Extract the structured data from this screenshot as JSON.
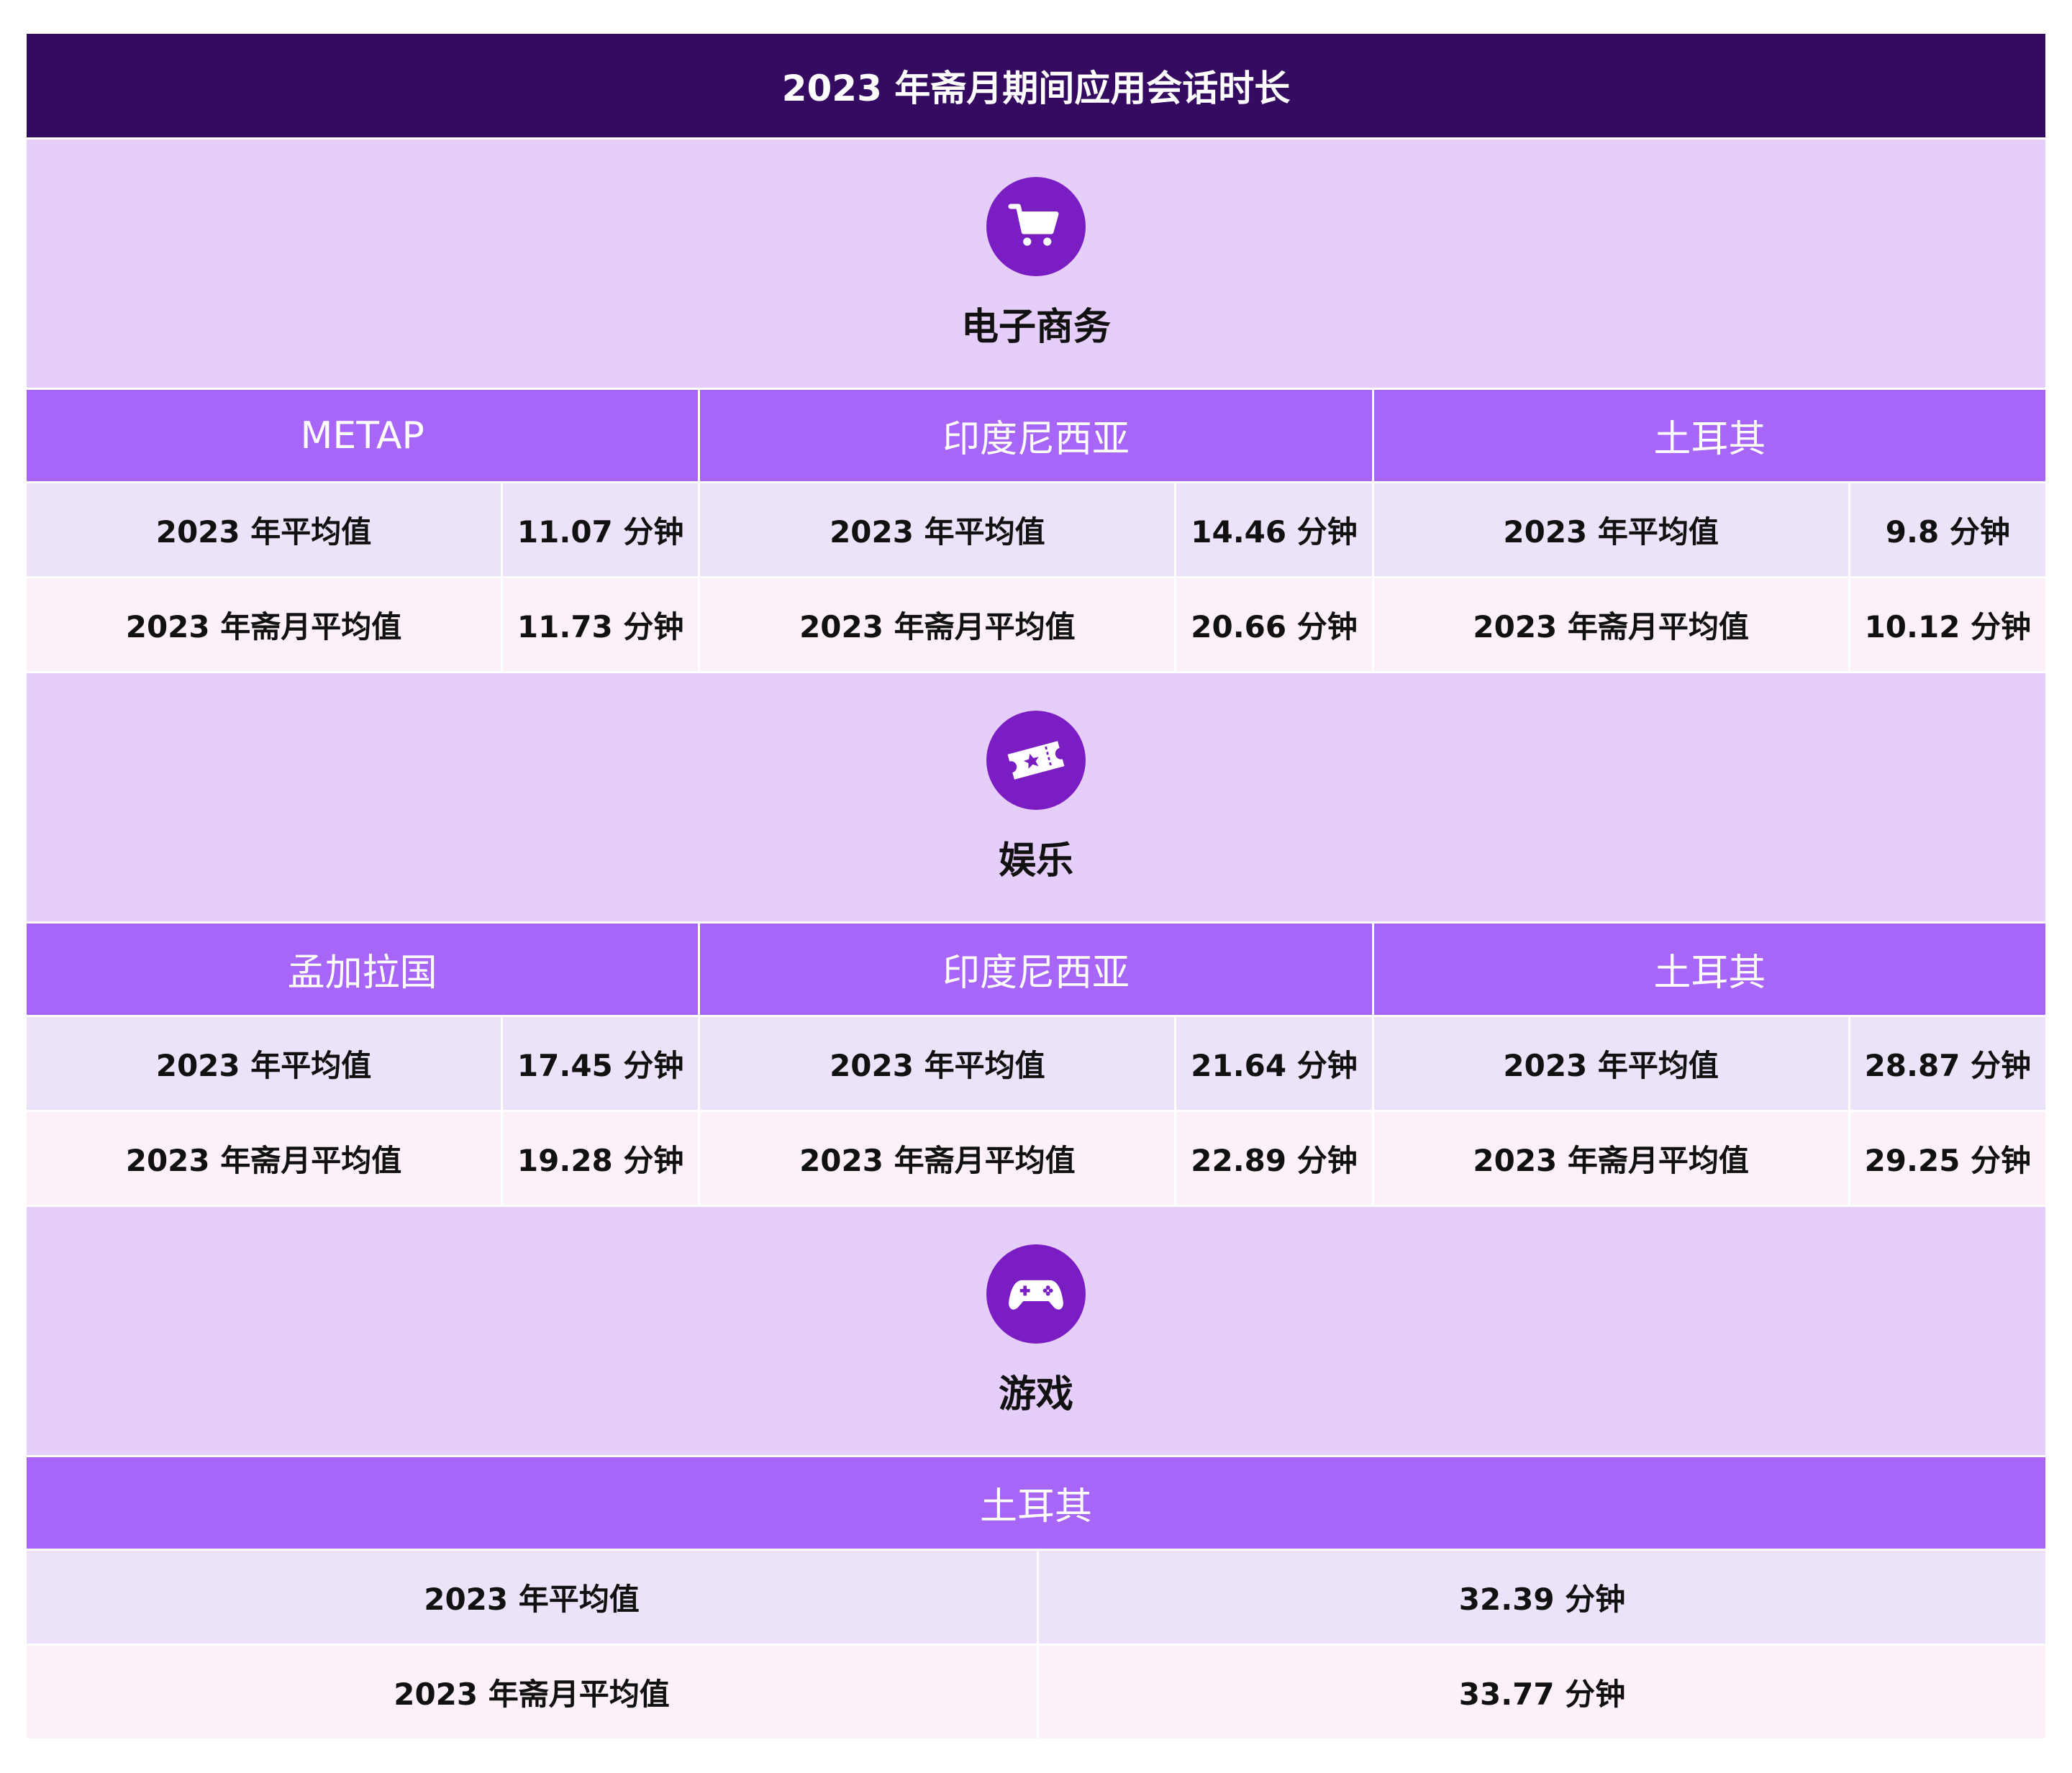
{
  "title": "2023 年斋月期间应用会话时长",
  "sections": [
    {
      "name": "电子商务",
      "icon": "shopping-cart-icon",
      "regions": [
        {
          "name": "METAP",
          "avg_label": "2023 年平均值",
          "avg_value": "11.07 分钟",
          "ramadan_label": "2023 年斋月平均值",
          "ramadan_value": "11.73 分钟"
        },
        {
          "name": "印度尼西亚",
          "avg_label": "2023 年平均值",
          "avg_value": "14.46 分钟",
          "ramadan_label": "2023 年斋月平均值",
          "ramadan_value": "20.66 分钟"
        },
        {
          "name": "土耳其",
          "avg_label": "2023 年平均值",
          "avg_value": "9.8 分钟",
          "ramadan_label": "2023 年斋月平均值",
          "ramadan_value": "10.12 分钟"
        }
      ]
    },
    {
      "name": "娱乐",
      "icon": "ticket-icon",
      "regions": [
        {
          "name": "孟加拉国",
          "avg_label": "2023 年平均值",
          "avg_value": "17.45 分钟",
          "ramadan_label": "2023 年斋月平均值",
          "ramadan_value": "19.28 分钟"
        },
        {
          "name": "印度尼西亚",
          "avg_label": "2023 年平均值",
          "avg_value": "21.64 分钟",
          "ramadan_label": "2023 年斋月平均值",
          "ramadan_value": "22.89 分钟"
        },
        {
          "name": "土耳其",
          "avg_label": "2023 年平均值",
          "avg_value": "28.87 分钟",
          "ramadan_label": "2023 年斋月平均值",
          "ramadan_value": "29.25 分钟"
        }
      ]
    },
    {
      "name": "游戏",
      "icon": "gamepad-icon",
      "regions": [
        {
          "name": "土耳其",
          "avg_label": "2023 年平均值",
          "avg_value": "32.39 分钟",
          "ramadan_label": "2023 年斋月平均值",
          "ramadan_value": "33.77 分钟"
        }
      ]
    }
  ],
  "colors": {
    "title_bg": "#350b62",
    "section_bg": "#e6cefa",
    "icon_circle": "#7a1ec3",
    "region_header_bg": "#a766f8",
    "row_avg_bg": "#ece2fa",
    "row_ramadan_bg": "#fcf0f9"
  }
}
